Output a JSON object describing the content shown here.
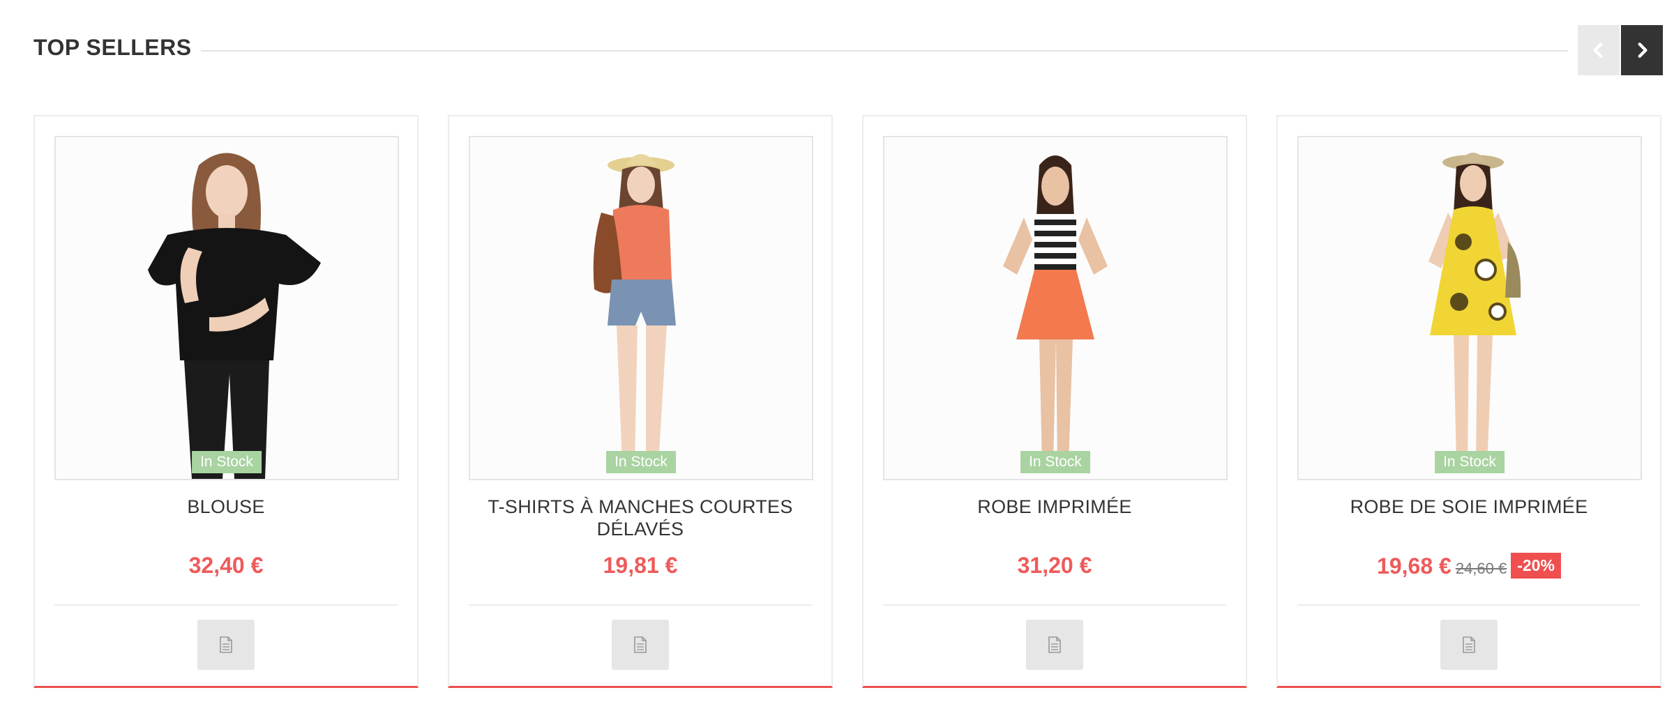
{
  "section": {
    "title": "TOP SELLERS",
    "prev_icon": "chevron-left-icon",
    "next_icon": "chevron-right-icon"
  },
  "products": [
    {
      "name": "BLOUSE",
      "price": "32,40 €",
      "old_price": "",
      "discount": "",
      "stock": "In Stock",
      "outfit": "black blouse, black trousers"
    },
    {
      "name": "T-SHIRTS À MANCHES COURTES DÉLAVÉS",
      "price": "19,81 €",
      "old_price": "",
      "discount": "",
      "stock": "In Stock",
      "outfit": "coral top, denim shorts, straw hat"
    },
    {
      "name": "ROBE IMPRIMÉE",
      "price": "31,20 €",
      "old_price": "",
      "discount": "",
      "stock": "In Stock",
      "outfit": "striped top, orange skirt"
    },
    {
      "name": "ROBE DE SOIE IMPRIMÉE",
      "price": "19,68 €",
      "old_price": "24,60 €",
      "discount": "-20%",
      "stock": "In Stock",
      "outfit": "yellow printed dress, straw hat"
    }
  ],
  "colors": {
    "accent": "#ef5a5a",
    "stock_badge": "#a9d3a1",
    "nav_active": "#333333",
    "nav_inactive": "#e9e9e9"
  },
  "detail_icon": "document-icon"
}
